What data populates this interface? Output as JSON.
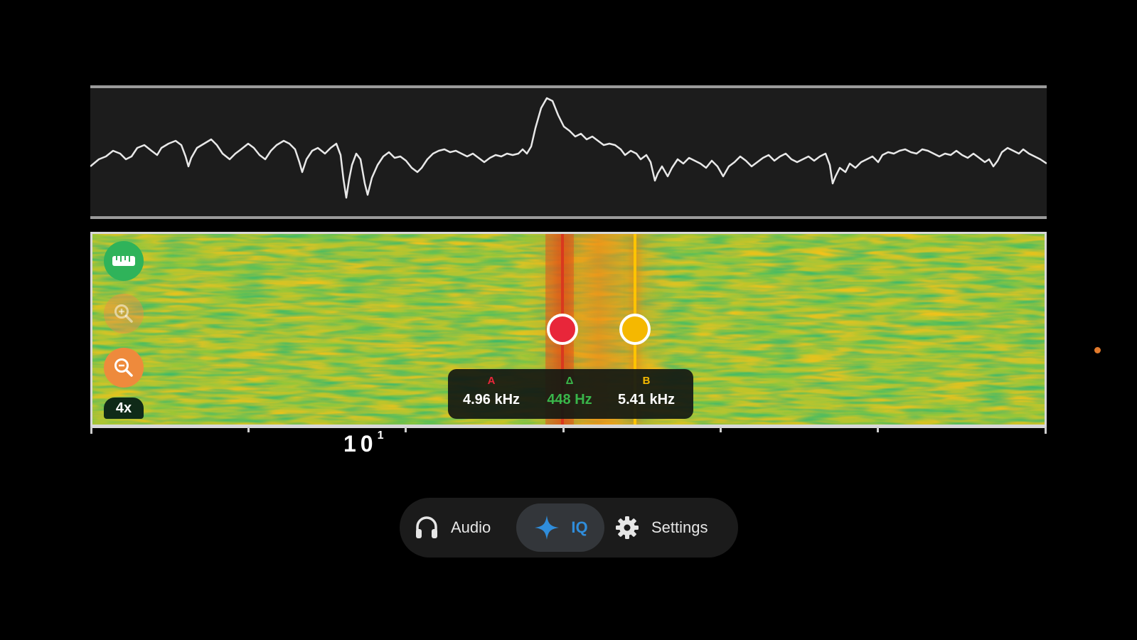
{
  "readout": {
    "a_label": "A",
    "delta_label": "Δ",
    "b_label": "B",
    "a_value": "4.96 kHz",
    "delta_value": "448 Hz",
    "b_value": "5.41 kHz"
  },
  "zoom_badge": "4x",
  "axis": {
    "base": "10",
    "exponent": "1"
  },
  "nav": {
    "audio_label": "Audio",
    "iq_label": "IQ",
    "settings_label": "Settings",
    "active": "IQ"
  },
  "colors": {
    "cursor_a": "#e8263a",
    "cursor_b": "#f5b800",
    "delta": "#39b54a",
    "active_tab": "#2f8ddb"
  },
  "icons": {
    "ruler": "ruler-icon",
    "zoom_in": "zoom-in-icon",
    "zoom_out": "zoom-out-icon",
    "audio": "headphones-icon",
    "iq": "iq-diamond-icon",
    "settings": "gear-icon"
  }
}
